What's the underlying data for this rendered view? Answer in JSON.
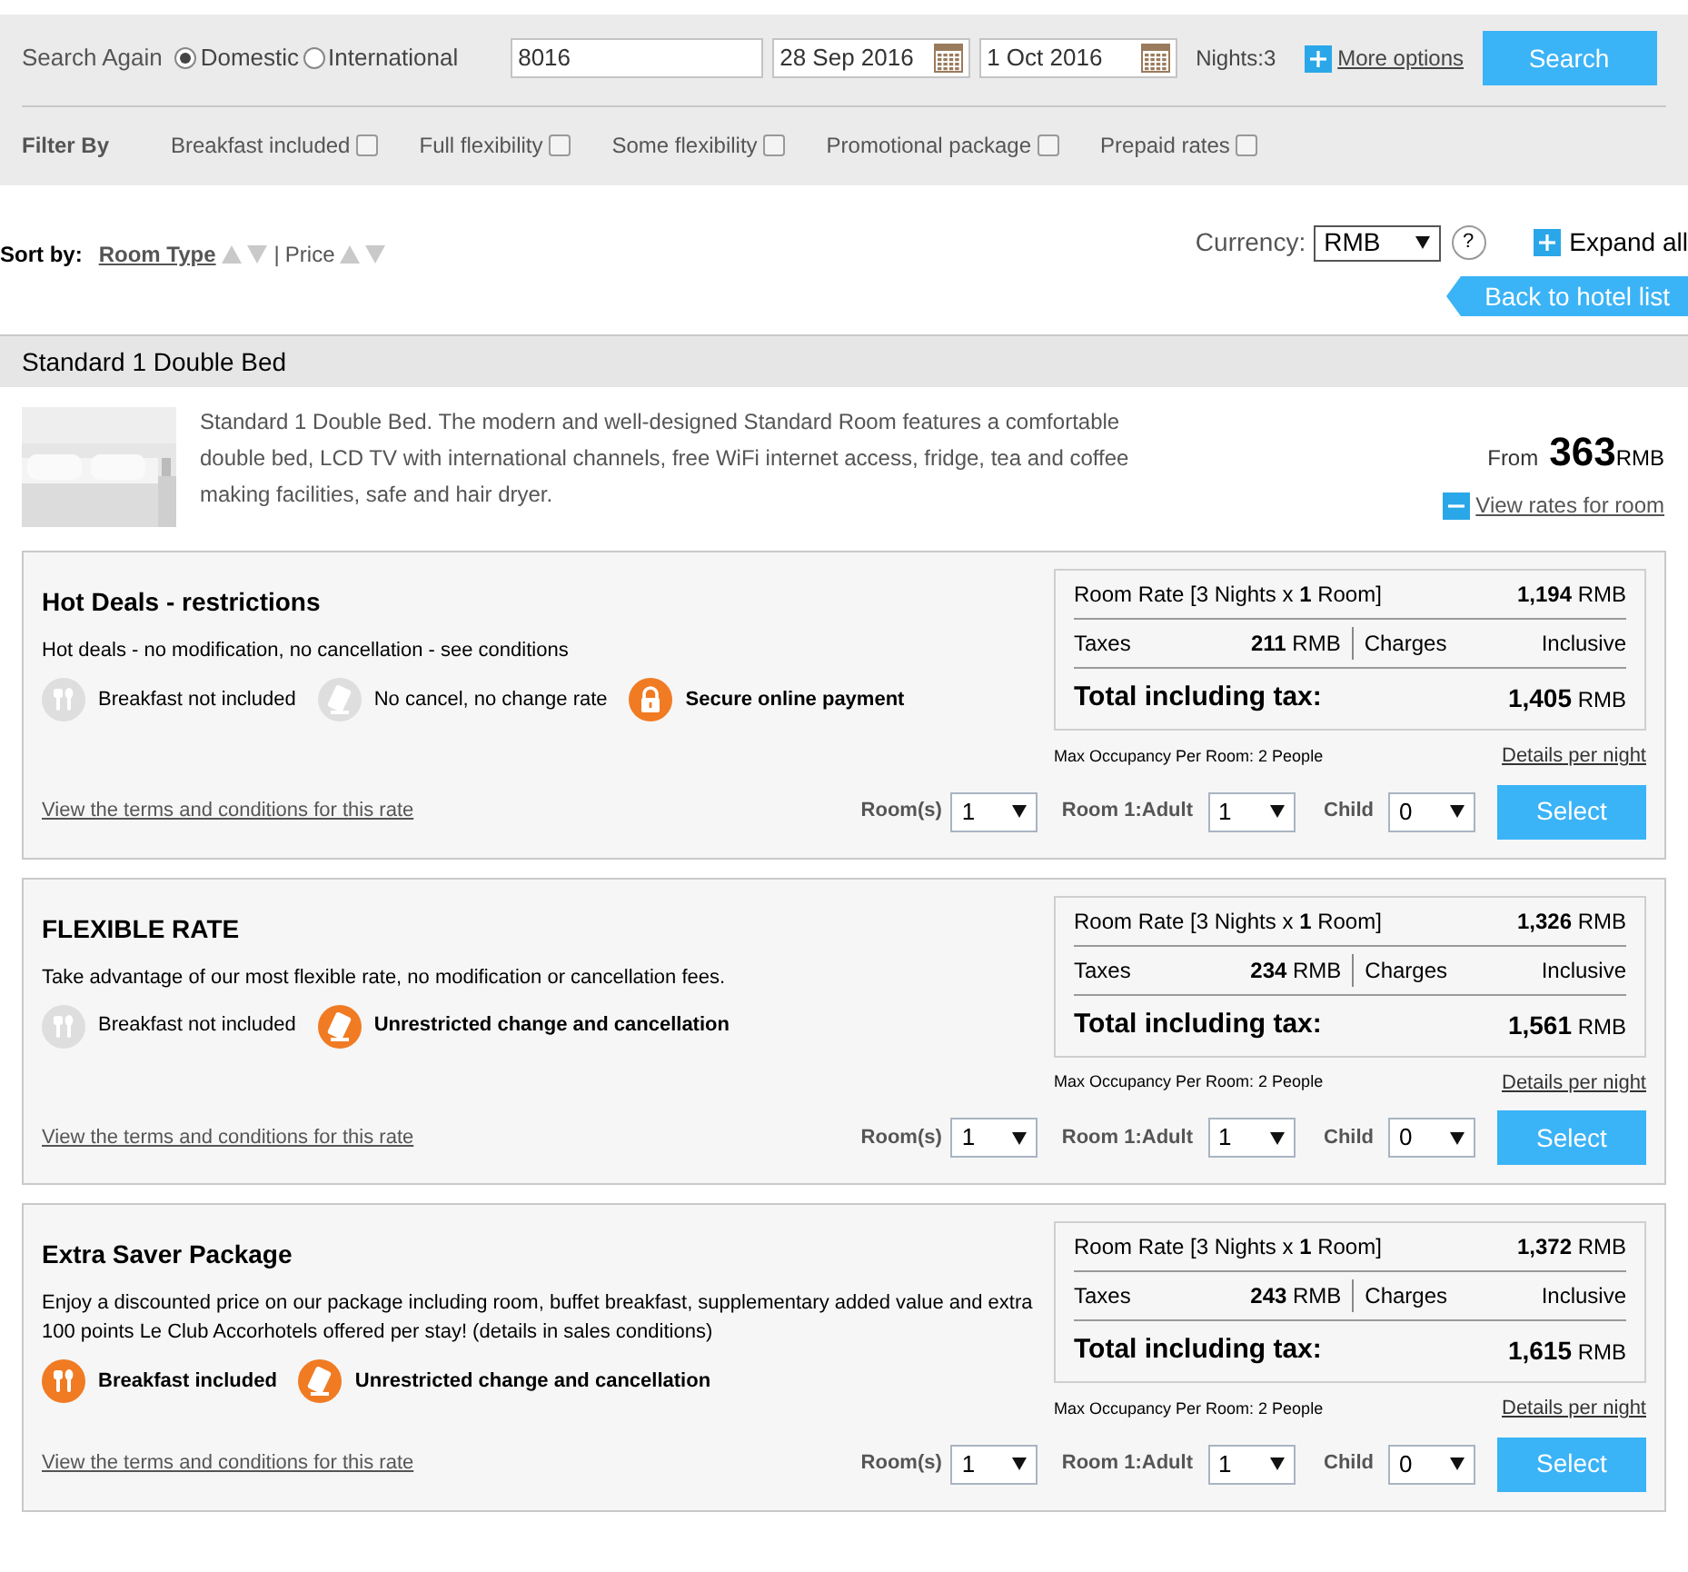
{
  "search": {
    "label": "Search Again",
    "scopes": [
      {
        "label": "Domestic",
        "selected": true
      },
      {
        "label": "International",
        "selected": false
      }
    ],
    "destination": "8016",
    "check_in": "28 Sep 2016",
    "check_out": "1 Oct 2016",
    "nights": "Nights:3",
    "more_options": "More options",
    "button": "Search"
  },
  "filters": {
    "label": "Filter By",
    "items": [
      {
        "label": "Breakfast included",
        "checked": false
      },
      {
        "label": "Full flexibility",
        "checked": false
      },
      {
        "label": "Some flexibility",
        "checked": false
      },
      {
        "label": "Promotional package",
        "checked": false
      },
      {
        "label": "Prepaid rates",
        "checked": false
      }
    ]
  },
  "sort": {
    "label": "Sort by:",
    "options": [
      {
        "label": "Room Type",
        "selected": true
      },
      {
        "label": "Price",
        "selected": false
      }
    ],
    "separator": "|"
  },
  "currency": {
    "label": "Currency:",
    "value": "RMB",
    "help": "?"
  },
  "expand_all": "Expand all",
  "back": "Back to hotel list",
  "room": {
    "title": "Standard 1 Double Bed",
    "description": "Standard 1 Double Bed. The modern and well-designed Standard Room features a comfortable double bed, LCD TV with international channels, free WiFi internet access, fridge, tea and coffee making facilities, safe and hair dryer.",
    "from": "From",
    "price": "363",
    "currency": "RMB",
    "view_rates": "View rates for room"
  },
  "rates": [
    {
      "title": "Hot Deals - restrictions",
      "description": "Hot deals - no modification, no cancellation - see conditions",
      "features": [
        {
          "kind": "breakfast",
          "label": "Breakfast not included",
          "active": false
        },
        {
          "kind": "change",
          "label": "No cancel, no change rate",
          "active": false
        },
        {
          "kind": "lock",
          "label": "Secure online payment",
          "active": true
        }
      ],
      "room_rate_label": "Room Rate [3 Nights x **1** Room]",
      "room_rate": "**1,194** RMB",
      "taxes_label": "Taxes",
      "taxes": "**211** RMB",
      "charges_label": "Charges",
      "charges": "Inclusive",
      "total_label": "Total including tax:",
      "total": "**1,405** RMB",
      "occupancy": "Max Occupancy Per Room: 2 People",
      "details": "Details per night",
      "terms": "View the terms and conditions for this rate",
      "rooms_label": "Room(s)",
      "rooms": "1",
      "adult_label": "Room 1:Adult",
      "adults": "1",
      "child_label": "Child",
      "children": "0",
      "select": "Select"
    },
    {
      "title": "FLEXIBLE RATE",
      "description": "Take advantage of our most flexible rate, no modification or cancellation fees.",
      "features": [
        {
          "kind": "breakfast",
          "label": "Breakfast not included",
          "active": false
        },
        {
          "kind": "change",
          "label": "Unrestricted change and cancellation",
          "active": true
        }
      ],
      "room_rate_label": "Room Rate [3 Nights x **1** Room]",
      "room_rate": "**1,326** RMB",
      "taxes_label": "Taxes",
      "taxes": "**234** RMB",
      "charges_label": "Charges",
      "charges": "Inclusive",
      "total_label": "Total including tax:",
      "total": "**1,561** RMB",
      "occupancy": "Max Occupancy Per Room: 2 People",
      "details": "Details per night",
      "terms": "View the terms and conditions for this rate",
      "rooms_label": "Room(s)",
      "rooms": "1",
      "adult_label": "Room 1:Adult",
      "adults": "1",
      "child_label": "Child",
      "children": "0",
      "select": "Select"
    },
    {
      "title": "Extra Saver Package",
      "description": "Enjoy a discounted price on our package including room, buffet breakfast, supplementary added value and extra 100 points Le Club Accorhotels offered per stay! (details in sales conditions)",
      "features": [
        {
          "kind": "breakfast",
          "label": "Breakfast included",
          "active": true
        },
        {
          "kind": "change",
          "label": "Unrestricted change and cancellation",
          "active": true
        }
      ],
      "room_rate_label": "Room Rate [3 Nights x **1** Room]",
      "room_rate": "**1,372** RMB",
      "taxes_label": "Taxes",
      "taxes": "**243** RMB",
      "charges_label": "Charges",
      "charges": "Inclusive",
      "total_label": "Total including tax:",
      "total": "**1,615** RMB",
      "occupancy": "Max Occupancy Per Room: 2 People",
      "details": "Details per night",
      "terms": "View the terms and conditions for this rate",
      "rooms_label": "Room(s)",
      "rooms": "1",
      "adult_label": "Room 1:Adult",
      "adults": "1",
      "child_label": "Child",
      "children": "0",
      "select": "Select"
    }
  ]
}
